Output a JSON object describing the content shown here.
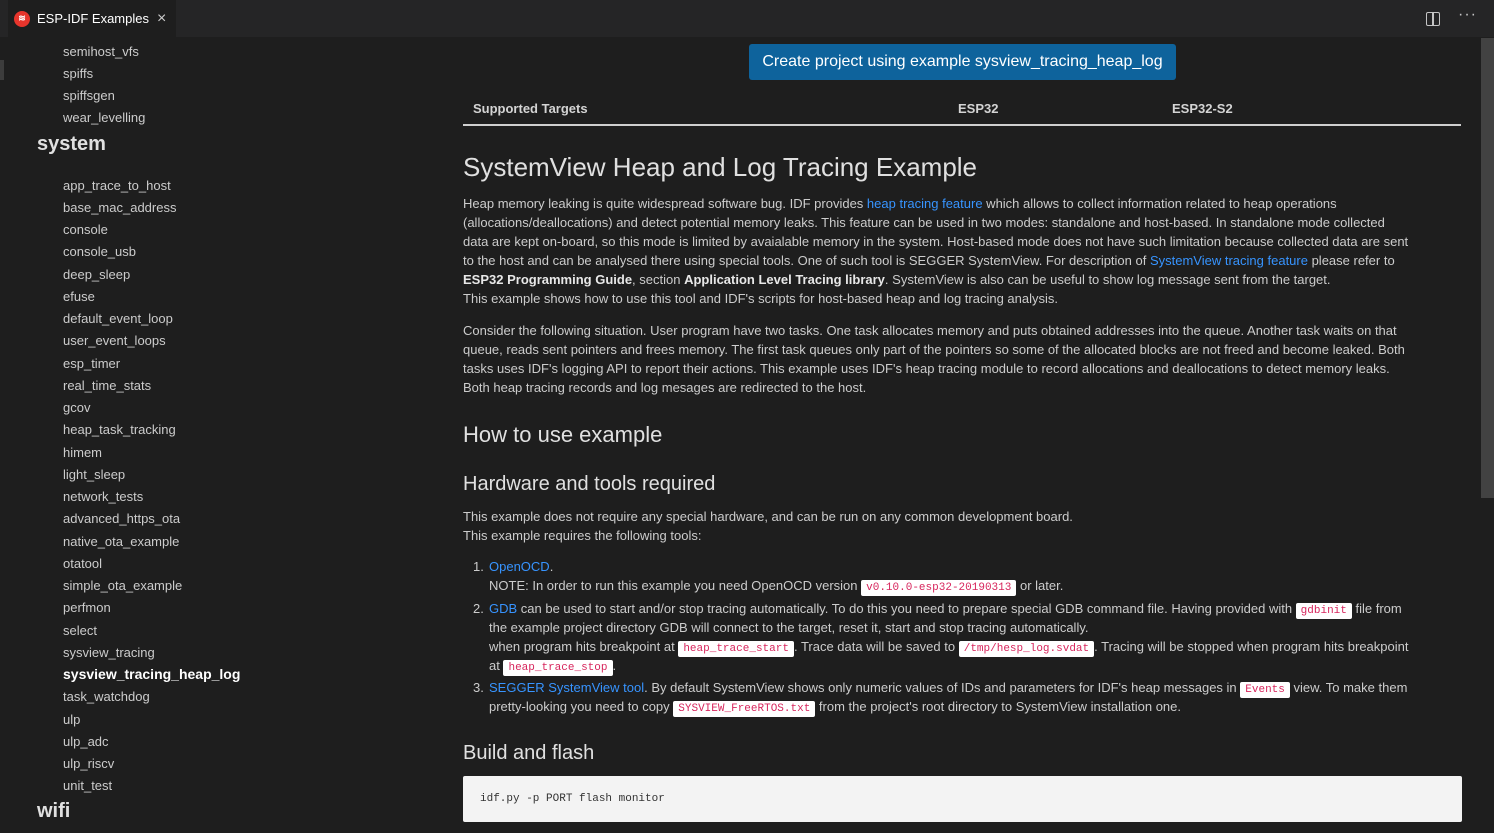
{
  "tab": {
    "title": "ESP-IDF Examples",
    "close": "×"
  },
  "sidebar": {
    "storage_items": [
      "semihost_vfs",
      "spiffs",
      "spiffsgen",
      "wear_levelling"
    ],
    "system_heading": "system",
    "system_items": [
      "app_trace_to_host",
      "base_mac_address",
      "console",
      "console_usb",
      "deep_sleep",
      "efuse",
      "default_event_loop",
      "user_event_loops",
      "esp_timer",
      "real_time_stats",
      "gcov",
      "heap_task_tracking",
      "himem",
      "light_sleep",
      "network_tests",
      "advanced_https_ota",
      "native_ota_example",
      "otatool",
      "simple_ota_example",
      "perfmon",
      "select",
      "sysview_tracing",
      "sysview_tracing_heap_log",
      "task_watchdog",
      "ulp",
      "ulp_adc",
      "ulp_riscv",
      "unit_test"
    ],
    "active_item": "sysview_tracing_heap_log",
    "wifi_heading": "wifi"
  },
  "main": {
    "create_button": "Create project using example sysview_tracing_heap_log",
    "targets": {
      "label": "Supported Targets",
      "esp32": "ESP32",
      "esp32s2": "ESP32-S2"
    },
    "title": "SystemView Heap and Log Tracing Example",
    "p1": {
      "a": "Heap memory leaking is quite widespread software bug. IDF provides ",
      "link1": "heap tracing feature",
      "b": " which allows to collect information related to heap operations",
      "c": "(allocations/deallocations) and detect potential memory leaks. This feature can be used in two modes: standalone and host-based. In standalone mode collected",
      "d": "data are kept on-board, so this mode is limited by avaialable memory in the system. Host-based mode does not have such limitation because collected data are sent",
      "e": "to the host and can be analysed there using special tools. One of such tool is SEGGER SystemView. For description of ",
      "link2": "SystemView tracing feature",
      "f": " please refer to",
      "bold1": "ESP32 Programming Guide",
      "g": ", section ",
      "bold2": "Application Level Tracing library",
      "h": ". SystemView is also can be useful to show log message sent from the target.",
      "i": "This example shows how to use this tool and IDF's scripts for host-based heap and log tracing analysis."
    },
    "p2": [
      "Consider the following situation. User program have two tasks. One task allocates memory and puts obtained addresses into the queue. Another task waits on that",
      "queue, reads sent pointers and frees memory. The first task queues only part of the pointers so some of the allocated blocks are not freed and become leaked. Both",
      "tasks uses IDF's logging API to report their actions. This example uses IDF's heap tracing module to record allocations and deallocations to detect memory leaks.",
      "Both heap tracing records and log mesages are redirected to the host."
    ],
    "h_how": "How to use example",
    "h_hw": "Hardware and tools required",
    "hw_lines": [
      "This example does not require any special hardware, and can be run on any common development board.",
      "This example requires the following tools:"
    ],
    "list": {
      "n1": "1.",
      "n2": "2.",
      "n3": "3.",
      "i1_link": "OpenOCD",
      "i1_a": ".",
      "i1_note": "NOTE: In order to run this example you need OpenOCD version ",
      "i1_code": "v0.10.0-esp32-20190313",
      "i1_b": " or later.",
      "i2_link": "GDB",
      "i2_a": " can be used to start and/or stop tracing automatically. To do this you need to prepare special GDB command file. Having provided with ",
      "i2_code1": "gdbinit",
      "i2_b": " file from",
      "i2_c": "the example project directory GDB will connect to the target, reset it, start and stop tracing automatically.",
      "i2_d": "when program hits breakpoint at ",
      "i2_code2": "heap_trace_start",
      "i2_e": ". Trace data will be saved to ",
      "i2_code3": "/tmp/hesp_log.svdat",
      "i2_f": ". Tracing will be stopped when program hits breakpoint",
      "i2_g": "at ",
      "i2_code4": "heap_trace_stop",
      "i2_h": ".",
      "i3_link": "SEGGER SystemView tool",
      "i3_a": ". By default SystemView shows only numeric values of IDs and parameters for IDF's heap messages in ",
      "i3_code1": "Events",
      "i3_b": " view. To make them",
      "i3_c": "pretty-looking you need to copy ",
      "i3_code2": "SYSVIEW_FreeRTOS.txt",
      "i3_d": " from the project's root directory to SystemView installation one."
    },
    "h_build": "Build and flash",
    "build_cmd": "idf.py -p PORT flash monitor"
  },
  "colors": {
    "accent": "#0e639c",
    "link": "#3794ff",
    "code": "#d7265d",
    "bg": "#1e1e1e"
  }
}
